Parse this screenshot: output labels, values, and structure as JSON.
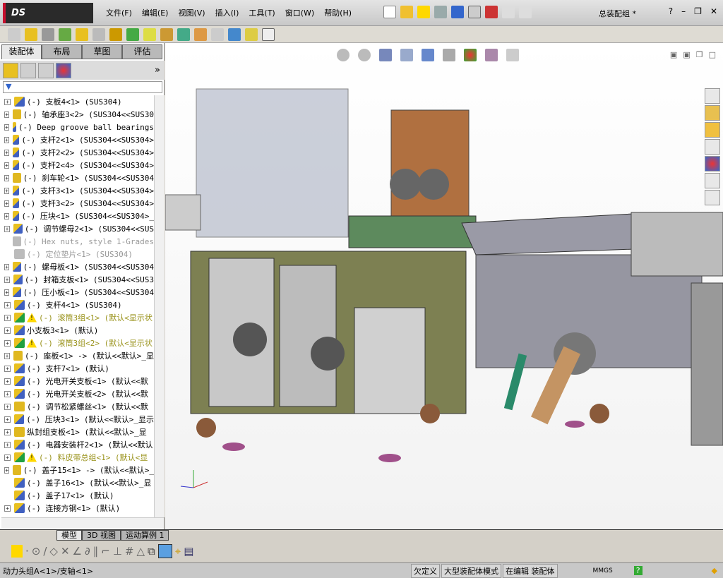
{
  "app": {
    "logo": "DS SOLIDWORKS",
    "document_title": "总装配组 *"
  },
  "menu": [
    "文件(F)",
    "编辑(E)",
    "视图(V)",
    "插入(I)",
    "工具(T)",
    "窗口(W)",
    "帮助(H)"
  ],
  "panel_tabs": [
    "装配体",
    "布局",
    "草图",
    "评估"
  ],
  "panel_more": "»",
  "tree": [
    {
      "label": "(-) 支板4<1> (SUS304)",
      "icon": "subassembly",
      "expand": true,
      "state": "normal"
    },
    {
      "label": "(-) 轴承座3<2> (SUS304<<SUS30",
      "icon": "part",
      "expand": true,
      "state": "normal"
    },
    {
      "label": "(-) Deep groove ball bearings",
      "icon": "toolbox",
      "expand": true,
      "state": "normal"
    },
    {
      "label": "(-) 支杆2<1> (SUS304<<SUS304>",
      "icon": "subassembly",
      "expand": true,
      "state": "normal"
    },
    {
      "label": "(-) 支杆2<2> (SUS304<<SUS304>",
      "icon": "subassembly",
      "expand": true,
      "state": "normal"
    },
    {
      "label": "(-) 支杆2<4> (SUS304<<SUS304>",
      "icon": "subassembly",
      "expand": true,
      "state": "normal"
    },
    {
      "label": "(-) 刹车轮<1> (SUS304<<SUS304",
      "icon": "part",
      "expand": true,
      "state": "normal"
    },
    {
      "label": "(-) 支杆3<1> (SUS304<<SUS304>",
      "icon": "subassembly",
      "expand": true,
      "state": "normal"
    },
    {
      "label": "(-) 支杆3<2> (SUS304<<SUS304>",
      "icon": "subassembly",
      "expand": true,
      "state": "normal"
    },
    {
      "label": "(-) 压块<1> (SUS304<<SUS304>_",
      "icon": "subassembly",
      "expand": true,
      "state": "normal"
    },
    {
      "label": "(-) 调节螺母2<1> (SUS304<<SUS",
      "icon": "subassembly",
      "expand": true,
      "state": "normal"
    },
    {
      "label": "(-) Hex nuts, style 1-Grades",
      "icon": "toolbox",
      "expand": false,
      "state": "suppressed"
    },
    {
      "label": "(-) 定位垫片<1> (SUS304)",
      "icon": "part",
      "expand": false,
      "state": "suppressed"
    },
    {
      "label": "(-) 螺母板<1> (SUS304<<SUS304",
      "icon": "subassembly",
      "expand": true,
      "state": "normal"
    },
    {
      "label": "(-) 封箱支板<1> (SUS304<<SUS3",
      "icon": "subassembly",
      "expand": true,
      "state": "normal"
    },
    {
      "label": "(-) 压小板<1> (SUS304<<SUS304",
      "icon": "subassembly",
      "expand": true,
      "state": "normal"
    },
    {
      "label": "(-) 支杆4<1> (SUS304)",
      "icon": "subassembly",
      "expand": true,
      "state": "normal"
    },
    {
      "label": "(-) 滚筒3组<1> (默认<显示状",
      "icon": "assembly",
      "expand": true,
      "state": "warning"
    },
    {
      "label": "小支板3<1> (默认)",
      "icon": "subassembly",
      "expand": true,
      "state": "normal"
    },
    {
      "label": "(-) 滚筒3组<2> (默认<显示状",
      "icon": "assembly",
      "expand": true,
      "state": "warning"
    },
    {
      "label": "(-) 座板<1> -> (默认<<默认>_显",
      "icon": "part",
      "expand": true,
      "state": "normal"
    },
    {
      "label": "(-) 支杆7<1> (默认)",
      "icon": "subassembly",
      "expand": true,
      "state": "normal"
    },
    {
      "label": "(-) 光电开关支板<1> (默认<<默",
      "icon": "subassembly",
      "expand": true,
      "state": "normal"
    },
    {
      "label": "(-) 光电开关支板<2> (默认<<默",
      "icon": "subassembly",
      "expand": true,
      "state": "normal"
    },
    {
      "label": "(-) 调节松紧螺丝<1> (默认<<默",
      "icon": "part",
      "expand": true,
      "state": "normal"
    },
    {
      "label": "(-) 压块3<1> (默认<<默认>_显示",
      "icon": "subassembly",
      "expand": true,
      "state": "normal"
    },
    {
      "label": "纵封组支板<1> (默认<<默认>_显",
      "icon": "part",
      "expand": true,
      "state": "normal"
    },
    {
      "label": "(-) 电器安装杆2<1> (默认<<默认",
      "icon": "subassembly",
      "expand": true,
      "state": "normal"
    },
    {
      "label": "(-) 料皮带总组<1> (默认<显",
      "icon": "assembly",
      "expand": true,
      "state": "warning"
    },
    {
      "label": "(-) 盖子15<1> -> (默认<<默认>_",
      "icon": "part",
      "expand": true,
      "state": "normal"
    },
    {
      "label": "(-) 盖子16<1> (默认<<默认>_显",
      "icon": "subassembly",
      "expand": false,
      "state": "normal"
    },
    {
      "label": "(-) 盖子17<1> (默认)",
      "icon": "subassembly",
      "expand": false,
      "state": "normal"
    },
    {
      "label": "(-) 连接方钢<1> (默认)",
      "icon": "subassembly",
      "expand": true,
      "state": "normal"
    }
  ],
  "bottom_tabs": [
    "模型",
    "3D 视图",
    "运动算例 1"
  ],
  "status": {
    "path": "动力头组A<1>/支轴<1>",
    "define": "欠定义",
    "mode": "大型装配体模式",
    "editing": "在编辑 装配体",
    "units": "MMGS",
    "help": "?"
  },
  "colors": {
    "frame": "#7d8052",
    "guard": "#b0b6c6",
    "machine_grey": "#8c8c98"
  }
}
